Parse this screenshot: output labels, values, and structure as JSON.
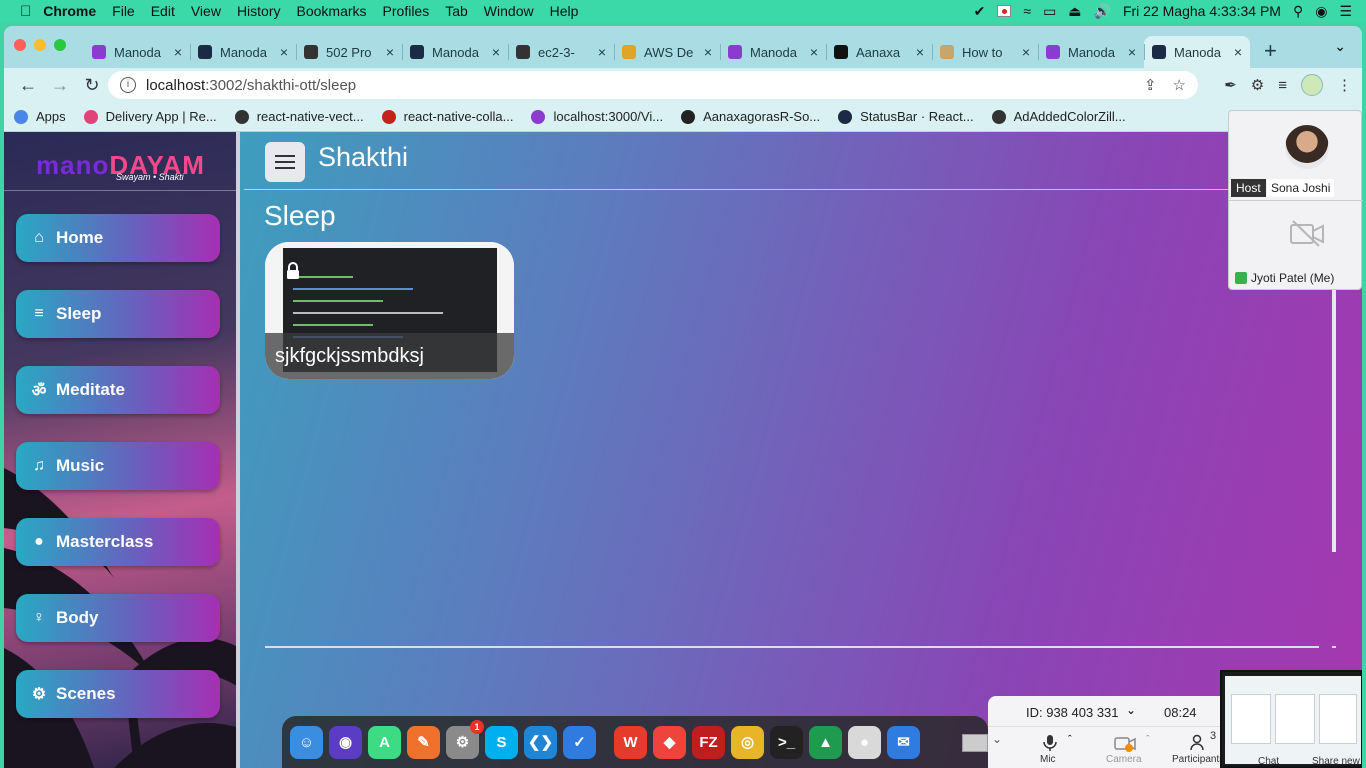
{
  "menubar": {
    "app": "Chrome",
    "items": [
      "File",
      "Edit",
      "View",
      "History",
      "Bookmarks",
      "Profiles",
      "Tab",
      "Window",
      "Help"
    ],
    "datetime": "Fri 22 Magha  4:33:34 PM"
  },
  "tabs": [
    {
      "label": "Manoda",
      "icon_color": "#8c3bd1"
    },
    {
      "label": "Manoda",
      "icon_color": "#1b2b46"
    },
    {
      "label": "502 Pro",
      "icon_color": "#333333"
    },
    {
      "label": "Manoda",
      "icon_color": "#1b2b46"
    },
    {
      "label": "ec2-3-",
      "icon_color": "#333333"
    },
    {
      "label": "AWS De",
      "icon_color": "#e0a526"
    },
    {
      "label": "Manoda",
      "icon_color": "#8c3bd1"
    },
    {
      "label": "Aanaxa",
      "icon_color": "#111111"
    },
    {
      "label": "How to",
      "icon_color": "#c9a46b"
    },
    {
      "label": "Manoda",
      "icon_color": "#8c3bd1"
    },
    {
      "label": "Manoda",
      "icon_color": "#1b2b46",
      "active": true
    }
  ],
  "address": {
    "host": "localhost",
    "path": ":3002/shakthi-ott/sleep"
  },
  "bookmarks": [
    {
      "label": "Apps",
      "color": "#4a86e8"
    },
    {
      "label": "Delivery App | Re...",
      "color": "#e0447a"
    },
    {
      "label": "react-native-vect...",
      "color": "#333333"
    },
    {
      "label": "react-native-colla...",
      "color": "#c4231c"
    },
    {
      "label": "localhost:3000/Vi...",
      "color": "#8c3bd1"
    },
    {
      "label": "AanaxagorasR-So...",
      "color": "#222222"
    },
    {
      "label": "StatusBar · React...",
      "color": "#1b2b46"
    },
    {
      "label": "AdAddedColorZill...",
      "color": "#333333"
    }
  ],
  "sidebar": {
    "logo_a": "mano",
    "logo_b": "DAYAM",
    "logo_sub": "Swayam • Shakti",
    "items": [
      {
        "label": "Home",
        "icon": "home-icon",
        "glyph": "⌂"
      },
      {
        "label": "Sleep",
        "icon": "bed-icon",
        "glyph": "≡"
      },
      {
        "label": "Meditate",
        "icon": "om-icon",
        "glyph": "ॐ"
      },
      {
        "label": "Music",
        "icon": "music-note-icon",
        "glyph": "♫"
      },
      {
        "label": "Masterclass",
        "icon": "lightbulb-icon",
        "glyph": "●"
      },
      {
        "label": "Body",
        "icon": "child-icon",
        "glyph": "♀"
      },
      {
        "label": "Scenes",
        "icon": "gear-icon",
        "glyph": "⚙"
      }
    ]
  },
  "header": {
    "title": "Shakthi"
  },
  "main": {
    "page_title": "Sleep",
    "cards": [
      {
        "caption": "sjkfgckjssmbdksj",
        "locked": true
      }
    ]
  },
  "zoom": {
    "host_badge": "Host",
    "host_name": "Sona Joshi",
    "me_name": "Jyoti Patel (Me)",
    "meeting_id": "ID: 938 403 331",
    "timer": "08:24",
    "controls": [
      "Mic",
      "Camera",
      "Participants",
      "Chat",
      "Share new"
    ],
    "participants_count": "3"
  },
  "dock": {
    "apps": [
      {
        "name": "finder",
        "color": "#3b8de0",
        "glyph": "☺"
      },
      {
        "name": "siri",
        "color": "#5b3cc4",
        "glyph": "◉"
      },
      {
        "name": "android-studio",
        "color": "#3ddc84",
        "glyph": "A"
      },
      {
        "name": "pencil-app",
        "color": "#f0712c",
        "glyph": "✎"
      },
      {
        "name": "system-preferences",
        "color": "#8a8a8a",
        "glyph": "⚙",
        "badge": "1"
      },
      {
        "name": "skype",
        "color": "#00aff0",
        "glyph": "S"
      },
      {
        "name": "vscode",
        "color": "#1f86d6",
        "glyph": "❮❯"
      },
      {
        "name": "mail-app",
        "color": "#2f7be0",
        "glyph": "✓"
      },
      {
        "name": "wps-office",
        "color": "#e43b2c",
        "glyph": "W"
      },
      {
        "name": "anydesk",
        "color": "#ef443b",
        "glyph": "◆"
      },
      {
        "name": "filezilla",
        "color": "#bf1e1e",
        "glyph": "FZ"
      },
      {
        "name": "chrome",
        "color": "#e8b428",
        "glyph": "◎"
      },
      {
        "name": "terminal",
        "color": "#222222",
        "glyph": ">_"
      },
      {
        "name": "mongodb",
        "color": "#1f9b4f",
        "glyph": "▲"
      },
      {
        "name": "recorder",
        "color": "#d9d9d9",
        "glyph": "●"
      },
      {
        "name": "mail-send",
        "color": "#2f7be0",
        "glyph": "✉"
      }
    ]
  }
}
